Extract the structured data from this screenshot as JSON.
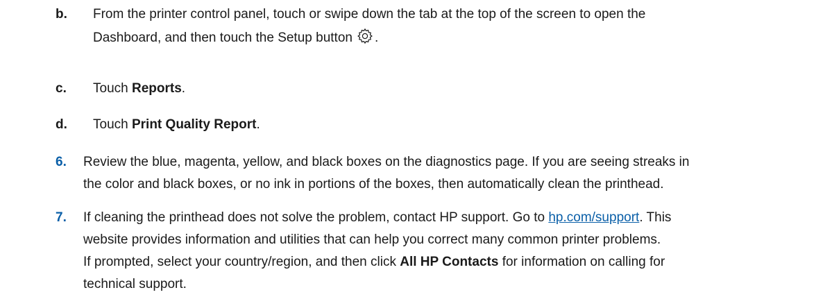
{
  "steps": {
    "b": {
      "marker": "b.",
      "line1": "From the printer control panel, touch or swipe down the tab at the top of the screen to open the",
      "line2_pre": "Dashboard, and then touch the Setup button",
      "line2_post": ".",
      "icon": "gear-icon"
    },
    "c": {
      "marker": "c.",
      "pre": "Touch ",
      "bold": "Reports",
      "post": "."
    },
    "d": {
      "marker": "d.",
      "pre": "Touch ",
      "bold": "Print Quality Report",
      "post": "."
    },
    "six": {
      "marker": "6.",
      "line1": "Review the blue, magenta, yellow, and black boxes on the diagnostics page. If you are seeing streaks in",
      "line2": "the color and black boxes, or no ink in portions of the boxes, then automatically clean the printhead."
    },
    "seven": {
      "marker": "7.",
      "line1_pre": "If cleaning the printhead does not solve the problem, contact HP support. Go to ",
      "link": "hp.com/support",
      "line1_post": ". This",
      "line2": "website provides information and utilities that can help you correct many common printer problems.",
      "line3_pre": "If prompted, select your country/region, and then click ",
      "line3_bold": "All HP Contacts",
      "line3_post": " for information on calling for",
      "line4": "technical support."
    }
  },
  "colors": {
    "accent": "#0a5fa8",
    "text": "#1a1a1a"
  }
}
